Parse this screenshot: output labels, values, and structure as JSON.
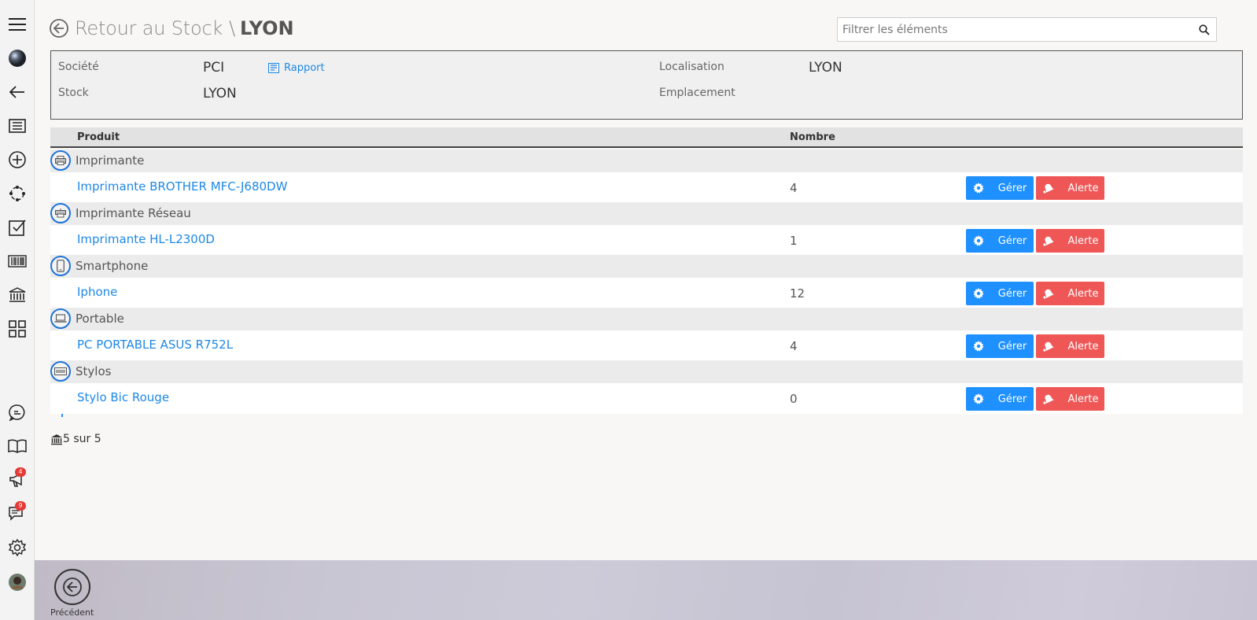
{
  "sidebar": {
    "badges": {
      "announcements": "4",
      "messages": "9"
    }
  },
  "header": {
    "back_label": "Retour au Stock",
    "separator": "\\",
    "current": "LYON"
  },
  "search": {
    "placeholder": "Filtrer les éléments",
    "value": ""
  },
  "info": {
    "societe_label": "Société",
    "societe_value": "PCI",
    "rapport_label": "Rapport",
    "stock_label": "Stock",
    "stock_value": "LYON",
    "localisation_label": "Localisation",
    "localisation_value": "LYON",
    "emplacement_label": "Emplacement",
    "emplacement_value": ""
  },
  "table": {
    "headers": {
      "produit": "Produit",
      "nombre": "Nombre"
    },
    "gerer_label": "Gérer",
    "alerte_label": "Alerte",
    "groups": [
      {
        "name": "Imprimante",
        "icon": "printer-icon",
        "product": "Imprimante BROTHER MFC-J680DW",
        "count": "4"
      },
      {
        "name": "Imprimante Réseau",
        "icon": "network-printer-icon",
        "product": "Imprimante HL-L2300D",
        "count": "1"
      },
      {
        "name": "Smartphone",
        "icon": "smartphone-icon",
        "product": "Iphone",
        "count": "12"
      },
      {
        "name": "Portable",
        "icon": "laptop-icon",
        "product": "PC PORTABLE ASUS R752L",
        "count": "4"
      },
      {
        "name": "Stylos",
        "icon": "keyboard-icon",
        "product": "Stylo Bic Rouge",
        "count": "0"
      }
    ]
  },
  "footer": {
    "count_text": "5 sur 5"
  },
  "bottombar": {
    "prev_label": "Précédent"
  },
  "colors": {
    "accent": "#1e90ff",
    "danger": "#ef5757"
  }
}
